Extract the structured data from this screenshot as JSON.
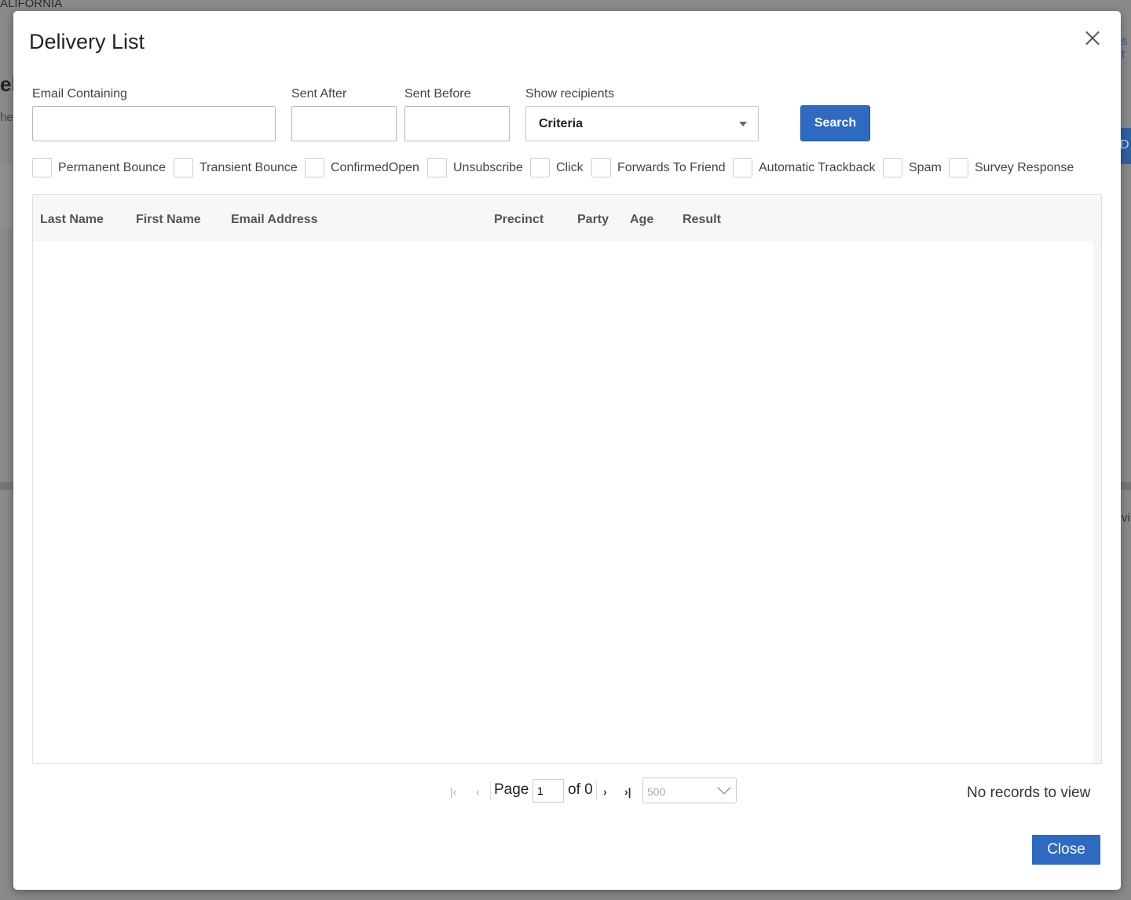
{
  "background": {
    "top_text": "ALIFORNIA",
    "heading_fragment": "el",
    "sub_fragment": "he",
    "right_link_fragment": "s t",
    "right_button_fragment": "D",
    "right_text_fragment": "vi"
  },
  "modal": {
    "title": "Delivery List",
    "close_icon": "close-icon"
  },
  "filters": {
    "email_label": "Email Containing",
    "email_value": "",
    "sent_after_label": "Sent After",
    "sent_after_value": "",
    "sent_before_label": "Sent Before",
    "sent_before_value": "",
    "show_recipients_label": "Show recipients",
    "show_recipients_value": "Criteria",
    "search_label": "Search"
  },
  "checkboxes": [
    {
      "label": "Permanent Bounce",
      "checked": false
    },
    {
      "label": "Transient Bounce",
      "checked": false
    },
    {
      "label": "ConfirmedOpen",
      "checked": false
    },
    {
      "label": "Unsubscribe",
      "checked": false
    },
    {
      "label": "Click",
      "checked": false
    },
    {
      "label": "Forwards To Friend",
      "checked": false
    },
    {
      "label": "Automatic Trackback",
      "checked": false
    },
    {
      "label": "Spam",
      "checked": false
    },
    {
      "label": "Survey Response",
      "checked": false
    }
  ],
  "grid": {
    "columns": [
      "Last Name",
      "First Name",
      "Email Address",
      "Precinct",
      "Party",
      "Age",
      "Result"
    ],
    "rows": []
  },
  "pager": {
    "page_label": "Page",
    "page_value": "1",
    "of_label": "of 0",
    "page_size": "500",
    "status": "No records to view"
  },
  "footer": {
    "close_label": "Close"
  }
}
